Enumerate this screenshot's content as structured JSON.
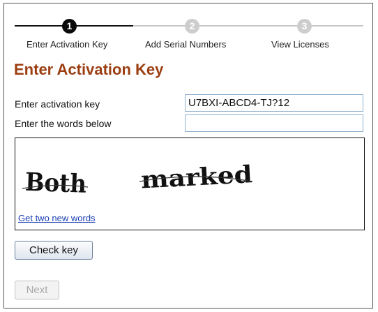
{
  "wizard": {
    "steps": [
      {
        "number": "1",
        "label": "Enter Activation Key"
      },
      {
        "number": "2",
        "label": "Add Serial Numbers"
      },
      {
        "number": "3",
        "label": "View Licenses"
      }
    ],
    "active_step": 1
  },
  "page": {
    "title": "Enter Activation Key"
  },
  "form": {
    "activation_key_label": "Enter activation key",
    "activation_key_value": "U7BXI-ABCD4-TJ?12",
    "words_label": "Enter the words below",
    "words_value": ""
  },
  "captcha": {
    "words": [
      "Both",
      "marked"
    ],
    "new_words_link": "Get two new words"
  },
  "buttons": {
    "check_key": "Check key",
    "next": "Next"
  },
  "colors": {
    "title": "#9b3e12",
    "link": "#1a3fb5",
    "active_step": "#0a0a0a",
    "inactive_step": "#cdcdcd"
  }
}
